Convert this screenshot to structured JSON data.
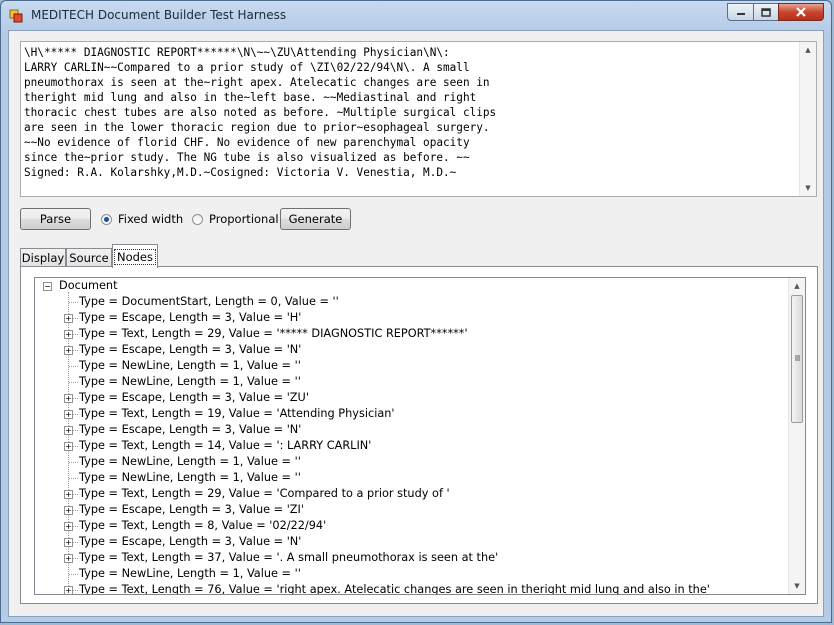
{
  "window": {
    "title": "MEDITECH Document Builder Test Harness"
  },
  "editor": {
    "text_lines": [
      "\\H\\***** DIAGNOSTIC REPORT******\\N\\~~\\ZU\\Attending Physician\\N\\:",
      "LARRY CARLIN~~Compared to a prior study of \\ZI\\02/22/94\\N\\. A small",
      "pneumothorax is seen at the~right apex. Atelecatic changes are seen in",
      "theright mid lung and also in the~left base. ~~Mediastinal and right",
      "thoracic chest tubes are also noted as before. ~Multiple surgical clips",
      "are seen in the lower thoracic region due to prior~esophageal surgery.",
      "~~No evidence of florid CHF. No evidence of new parenchymal opacity",
      "since the~prior study. The NG tube is also visualized as before. ~~",
      "Signed: R.A. Kolarshky,M.D.~Cosigned: Victoria V. Venestia, M.D.~"
    ]
  },
  "toolbar": {
    "parse_label": "Parse",
    "fixed_width_label": "Fixed width",
    "proportional_label": "Proportional",
    "generate_label": "Generate",
    "selected_mode": "Fixed width"
  },
  "tabs": [
    {
      "label": "Display"
    },
    {
      "label": "Source"
    },
    {
      "label": "Nodes"
    }
  ],
  "active_tab": "Nodes",
  "tree": {
    "root_label": "Document",
    "nodes": [
      {
        "label": "Type = DocumentStart, Length = 0, Value = ''",
        "expandable": false
      },
      {
        "label": "Type = Escape, Length = 3, Value = 'H'",
        "expandable": true
      },
      {
        "label": "Type = Text, Length = 29, Value = '***** DIAGNOSTIC REPORT******'",
        "expandable": true
      },
      {
        "label": "Type = Escape, Length = 3, Value = 'N'",
        "expandable": true
      },
      {
        "label": "Type = NewLine, Length = 1, Value = ''",
        "expandable": false
      },
      {
        "label": "Type = NewLine, Length = 1, Value = ''",
        "expandable": false
      },
      {
        "label": "Type = Escape, Length = 3, Value = 'ZU'",
        "expandable": true
      },
      {
        "label": "Type = Text, Length = 19, Value = 'Attending Physician'",
        "expandable": true
      },
      {
        "label": "Type = Escape, Length = 3, Value = 'N'",
        "expandable": true
      },
      {
        "label": "Type = Text, Length = 14, Value = ': LARRY CARLIN'",
        "expandable": true
      },
      {
        "label": "Type = NewLine, Length = 1, Value = ''",
        "expandable": false
      },
      {
        "label": "Type = NewLine, Length = 1, Value = ''",
        "expandable": false
      },
      {
        "label": "Type = Text, Length = 29, Value = 'Compared to a prior study of '",
        "expandable": true
      },
      {
        "label": "Type = Escape, Length = 3, Value = 'ZI'",
        "expandable": true
      },
      {
        "label": "Type = Text, Length = 8, Value = '02/22/94'",
        "expandable": true
      },
      {
        "label": "Type = Escape, Length = 3, Value = 'N'",
        "expandable": true
      },
      {
        "label": "Type = Text, Length = 37, Value = '. A small pneumothorax is seen at the'",
        "expandable": true
      },
      {
        "label": "Type = NewLine, Length = 1, Value = ''",
        "expandable": false
      },
      {
        "label": "Type = Text, Length = 76, Value = 'right apex. Atelecatic changes are seen in theright mid lung and also in the'",
        "expandable": true
      }
    ]
  }
}
